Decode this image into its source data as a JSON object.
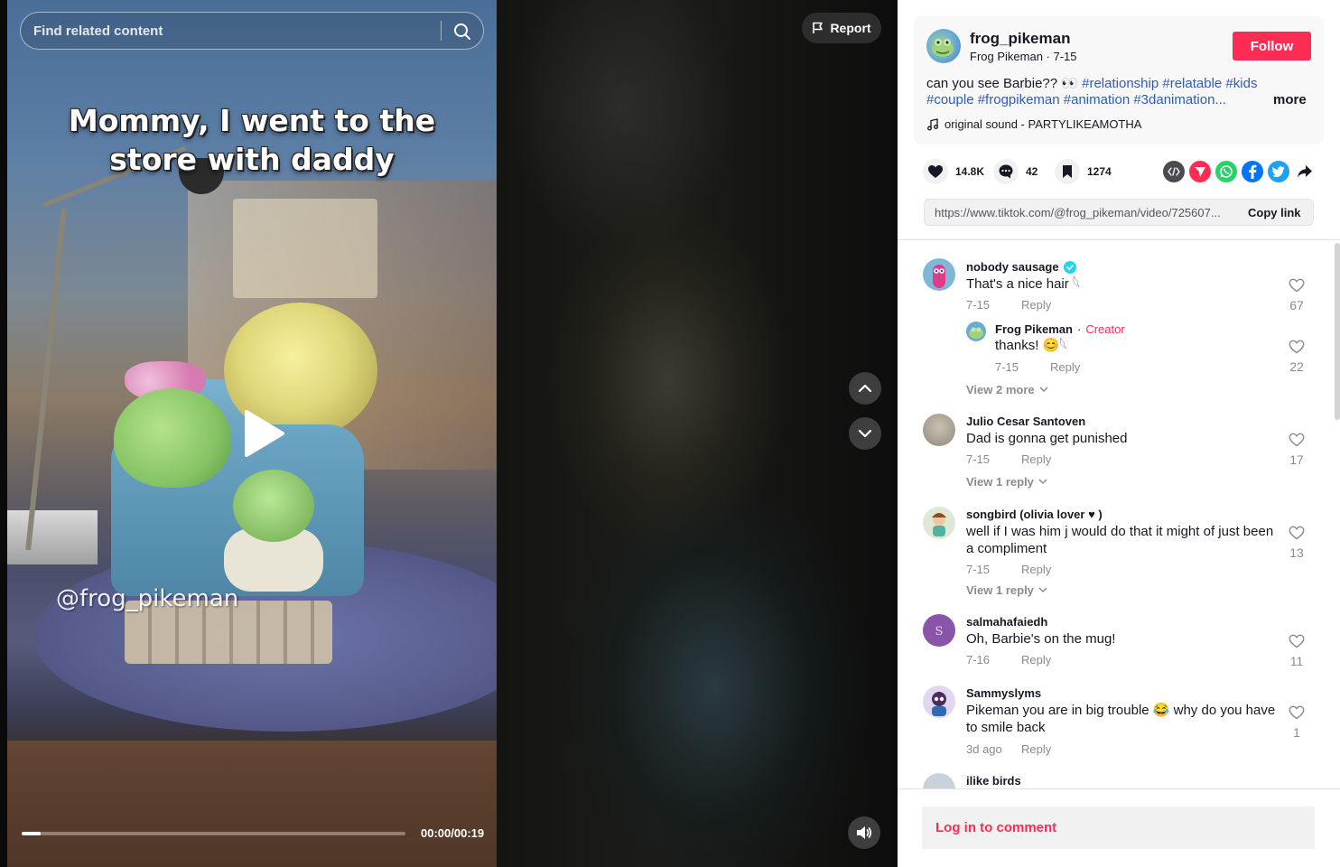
{
  "video": {
    "search_placeholder": "Find related content",
    "caption_line1": "Mommy, I went to the",
    "caption_line2": "store with daddy",
    "watermark": "@frog_pikeman",
    "time": "00:00/00:19",
    "progress_fraction": 0.05,
    "report_label": "Report"
  },
  "author": {
    "handle": "frog_pikeman",
    "display_name": "Frog Pikeman",
    "date": "7-15",
    "follow_label": "Follow"
  },
  "description": {
    "text": "can you see Barbie?? 👀",
    "tags": [
      "#relationship",
      "#relatable",
      "#kids",
      "#couple",
      "#frogpikeman",
      "#animation",
      "#3danimation..."
    ],
    "more_label": "more"
  },
  "music": {
    "label": "original sound - PARTYLIKEAMOTHA"
  },
  "actions": {
    "likes": "14.8K",
    "comments": "42",
    "saves": "1274"
  },
  "share": {
    "icons": [
      "embed-icon",
      "send-icon",
      "whatsapp-icon",
      "facebook-icon",
      "twitter-icon",
      "share-arrow-icon"
    ],
    "colors": {
      "embed": "#4a4a4f",
      "send": "#fe2c55",
      "whatsapp": "#25d366",
      "facebook": "#0075fa",
      "twitter": "#1da1f2"
    }
  },
  "link": {
    "url": "https://www.tiktok.com/@frog_pikeman/video/725607...",
    "copy_label": "Copy link"
  },
  "comments": [
    {
      "name": "nobody sausage",
      "verified": true,
      "text": "That's a nice hair 𓆩",
      "date": "7-15",
      "reply_label": "Reply",
      "likes": "67"
    },
    {
      "name": "Frog Pikeman",
      "creator_label": "Creator",
      "text": "thanks! 😊𓆩",
      "date": "7-15",
      "reply_label": "Reply",
      "likes": "22"
    },
    {
      "name": "Julio Cesar Santoven",
      "text": "Dad is gonna get punished",
      "date": "7-15",
      "reply_label": "Reply",
      "likes": "17"
    },
    {
      "name": "songbird (olivia lover ♥ )",
      "text": "well if I was him j would do that it might of just been a compliment",
      "date": "7-15",
      "reply_label": "Reply",
      "likes": "13"
    },
    {
      "name": "salmahafaiedh",
      "text": "Oh, Barbie's on the mug!",
      "date": "7-16",
      "reply_label": "Reply",
      "likes": "11"
    },
    {
      "name": "Sammyslyms",
      "text": "Pikeman you are in big trouble 😂 why do you have to smile back",
      "date": "3d ago",
      "reply_label": "Reply",
      "likes": "1"
    },
    {
      "name": "ilike birds"
    }
  ],
  "view_more": {
    "first": "View 2 more",
    "second": "View 1 reply",
    "third": "View 1 reply"
  },
  "login": {
    "label": "Log in to comment"
  }
}
